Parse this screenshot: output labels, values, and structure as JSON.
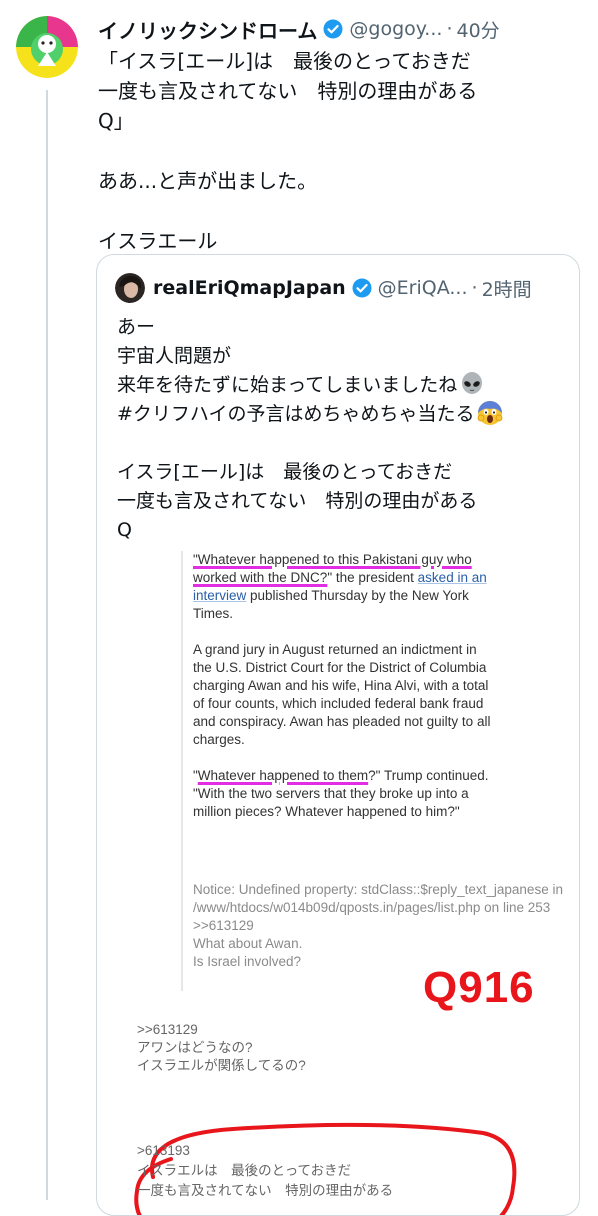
{
  "tweet": {
    "author_name": "イノリックシンドローム",
    "handle": "@gogoy...",
    "separator": "·",
    "time": "40分",
    "text": "「イスラ[エール]は　最後のとっておきだ\n一度も言及されてない　特別の理由がある\nQ」\n\nああ...と声が出ました。\n\nイスラエール"
  },
  "quote": {
    "author_name": "realEriQmapJapan",
    "handle": "@EriQA...",
    "separator": "·",
    "time": "2時間",
    "text_lines": [
      "あー",
      "宇宙人問題が",
      "来年を待たずに始まってしまいましたね",
      "#クリフハイの予言はめちゃめちゃ当たる",
      "",
      "イスラ[エール]は　最後のとっておきだ",
      "一度も言及されてない　特別の理由がある",
      "Q"
    ],
    "emoji_1": "alien-emoji",
    "emoji_2": "screaming-face-emoji"
  },
  "image": {
    "para1_a": "\"Whatever happened to this Pakistani guy who",
    "para1_b": "worked with the DNC?",
    "para1_c": "\" the president ",
    "para1_link": "asked in an interview",
    "para1_d": " published Thursday by the New York Times.",
    "para2": "A grand jury in August returned an indictment in the U.S. District Court for the District of Columbia charging Awan and his wife, Hina Alvi, with a total of four counts, which included federal bank fraud and conspiracy. Awan has pleaded not guilty to all charges.",
    "para3_a": "\"",
    "para3_hl": "Whatever happened to them",
    "para3_b": "?\" Trump continued. \"With the two servers that they broke up into a million pieces? Whatever happened to him?\"",
    "notice": "Notice: Undefined property: stdClass::$reply_text_japanese in\n/www/htdocs/w014b09d/qposts.in/pages/list.php on line 253\n>>613129\nWhat about Awan.\nIs Israel involved?",
    "stamp": "Q916",
    "reply_1": ">>613129\nアワンはどうなの?\nイスラエルが関係してるの?",
    "reply_2": ">613193\nイスラエルは　最後のとっておきだ\n一度も言及されてない　特別の理由がある"
  },
  "colors": {
    "verified": "#1d9bf0",
    "highlight": "#e32de3",
    "stamp": "#e8161b",
    "circle": "#e8161b"
  }
}
